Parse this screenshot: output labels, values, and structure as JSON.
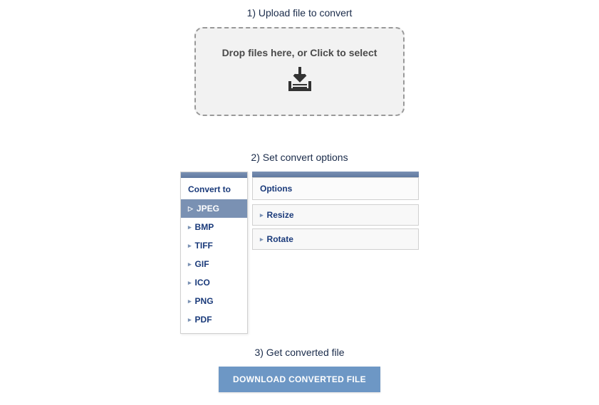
{
  "step1": {
    "title": "1) Upload file to convert",
    "dropzone_text": "Drop files here, or Click to select"
  },
  "step2": {
    "title": "2) Set convert options",
    "convert_to_label": "Convert to",
    "formats": [
      {
        "label": "JPEG",
        "selected": true
      },
      {
        "label": "BMP",
        "selected": false
      },
      {
        "label": "TIFF",
        "selected": false
      },
      {
        "label": "GIF",
        "selected": false
      },
      {
        "label": "ICO",
        "selected": false
      },
      {
        "label": "PNG",
        "selected": false
      },
      {
        "label": "PDF",
        "selected": false
      }
    ],
    "options_label": "Options",
    "option_items": [
      {
        "label": "Resize"
      },
      {
        "label": "Rotate"
      }
    ]
  },
  "step3": {
    "title": "3) Get converted file",
    "download_label": "DOWNLOAD CONVERTED FILE"
  }
}
